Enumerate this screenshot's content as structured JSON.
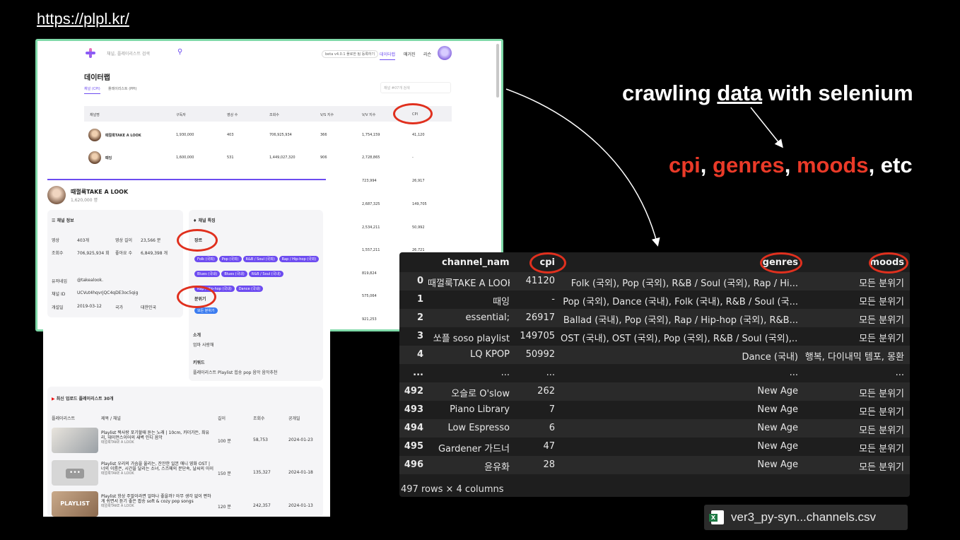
{
  "url": "https://plpl.kr/",
  "site": {
    "search_placeholder": "채널, 플레이리스트 검색",
    "beta_label": "beta v4.0.1 플로한 팀 등록하기",
    "nav": [
      "데이터랩",
      "매거진",
      "리슨"
    ],
    "title": "데이터랩",
    "tabs": [
      "채널 (CPI)",
      "플레이리스트 (PPI)"
    ],
    "filter_placeholder": "채널 #07개 검색",
    "table_headers": [
      "채널명",
      "구독자",
      "영상 수",
      "조회수",
      "V/S 지수",
      "V/V 지수",
      "CPI"
    ],
    "rows": [
      {
        "name": "때껄룩TAKE A LOOK",
        "subs": "1,930,000",
        "videos": "403",
        "views": "706,925,934",
        "vs": "366",
        "vv": "1,754,159",
        "cpi": "41,120"
      },
      {
        "name": "때잉",
        "subs": "1,600,000",
        "videos": "531",
        "views": "1,449,027,320",
        "vs": "906",
        "vv": "2,728,865",
        "cpi": "-"
      }
    ],
    "right_cols": [
      [
        "723,994",
        "26,917"
      ],
      [
        "2,687,325",
        "149,705"
      ],
      [
        "2,534,211",
        "50,992"
      ],
      [
        "1,557,211",
        "26,721"
      ],
      [
        "819,824",
        ""
      ],
      [
        "575,064",
        ""
      ],
      [
        "921,253",
        ""
      ]
    ]
  },
  "popup": {
    "name": "때껄룩TAKE A LOOK",
    "subs": "1,620,000 명",
    "info_title": "채널 정보",
    "feature_title": "채널 특징",
    "info": [
      {
        "k": "영상",
        "v": "403개",
        "k2": "영상 길이",
        "v2": "23,566 분"
      },
      {
        "k": "조회수",
        "v": "706,925,934 회",
        "k2": "좋아요 수",
        "v2": "6,849,398 개"
      },
      {
        "k": "유저네임",
        "v": "@takealook."
      },
      {
        "k": "채널 ID",
        "v": "UCVut4hqvrjQC4qDE3oc5qig"
      },
      {
        "k": "개설일",
        "v": "2019-03-12",
        "k2": "국가",
        "v2": "대한민국"
      }
    ],
    "genre_label": "장르",
    "genres": [
      "Folk (국외)",
      "Pop (국외)",
      "R&B / Soul (국외)",
      "Rap / Hip-hop (국외)",
      "Blues (국내)",
      "Blues (국내)",
      "R&B / Soul (국내)",
      "Rap / Hip-hop (국내)",
      "Dance (국내)"
    ],
    "mood_label": "분위기",
    "mood": "모든 분위기",
    "intro_label": "소개",
    "intro": "엄마 사랑해",
    "keyword_label": "키워드",
    "keywords": "플레이리스트 Playlist 힙송 pop 음악 음악추천",
    "recent_title": "최신 업로드 플레이리스트 30개",
    "pl_headers": [
      "플레이리스트",
      "제목 / 채널",
      "길이",
      "조회수",
      "공개일"
    ],
    "playlists": [
      {
        "title": "Playlist 짝사랑 포기할때 듣는 노래 | 10cm, 카더가든, 최유리, 데이먼스이어의 새벽 인디 음악",
        "channel": "때껄룩TAKE A LOOK",
        "len": "100 분",
        "views": "58,753",
        "date": "2024-01-23"
      },
      {
        "title": "Playlist 우리의 가슴을 울리는, 잔잔한 일본 애니 영화 OST | 너의 이름은, 시간을 달리는 소녀, 스즈메의 문단속, 날씨의 아이",
        "channel": "때껄룩TAKE A LOOK",
        "len": "150 분",
        "views": "135,327",
        "date": "2024-01-18"
      },
      {
        "title": "Playlist 항상 주말이라면 얼마나 좋을까? 아무 생각 없이 편하게 쉬면서 듣기 좋은 팝송 soft & cozy pop songs",
        "channel": "때껄룩TAKE A LOOK",
        "len": "120 분",
        "views": "242,357",
        "date": "2024-01-13"
      }
    ],
    "thumb3_label": "PLAYLIST"
  },
  "crawl": {
    "prefix": "crawling ",
    "underlined": "data",
    "suffix": " with selenium"
  },
  "fields": [
    {
      "text": "cpi",
      "color": "red"
    },
    {
      "text": ", ",
      "color": "white"
    },
    {
      "text": "genres",
      "color": "red"
    },
    {
      "text": ", ",
      "color": "white"
    },
    {
      "text": "moods",
      "color": "red"
    },
    {
      "text": ", etc",
      "color": "white"
    }
  ],
  "dataframe": {
    "columns": [
      "",
      "channel_name",
      "cpi",
      "genres",
      "moods"
    ],
    "rows": [
      [
        "0",
        "때껄룩TAKE A LOOK",
        "41120",
        "Folk (국외), Pop (국외), R&B / Soul (국외), Rap / Hi...",
        "모든 분위기"
      ],
      [
        "1",
        "때잉",
        "-",
        "Pop (국외), Dance (국내), Folk (국내), R&B / Soul (국...",
        "모든 분위기"
      ],
      [
        "2",
        "essential;",
        "26917",
        "Ballad (국내), Pop (국외), Rap / Hip-hop (국외), R&B...",
        "모든 분위기"
      ],
      [
        "3",
        "쏘플 soso playlist",
        "149705",
        "OST (국내), OST (국외), Pop (국외), R&B / Soul (국외),...",
        "모든 분위기"
      ],
      [
        "4",
        "LQ KPOP",
        "50992",
        "Dance (국내)",
        "행복, 다이내믹 템포, 몽환"
      ],
      [
        "...",
        "...",
        "...",
        "...",
        "..."
      ],
      [
        "492",
        "오슬로 O'slow",
        "262",
        "New Age",
        "모든 분위기"
      ],
      [
        "493",
        "Piano Library",
        "7",
        "New Age",
        "모든 분위기"
      ],
      [
        "494",
        "Low Espresso",
        "6",
        "New Age",
        "모든 분위기"
      ],
      [
        "495",
        "Gardener 가드너",
        "47",
        "New Age",
        "모든 분위기"
      ],
      [
        "496",
        "윤유화",
        "28",
        "New Age",
        "모든 분위기"
      ]
    ],
    "footer": "497 rows × 4 columns"
  },
  "file": {
    "name": "ver3_py-syn...channels.csv",
    "icon": "excel-icon"
  },
  "colors": {
    "accent_red": "#ea3a28",
    "site_purple": "#6d4cf0",
    "frame_green": "#7fd9a8"
  }
}
